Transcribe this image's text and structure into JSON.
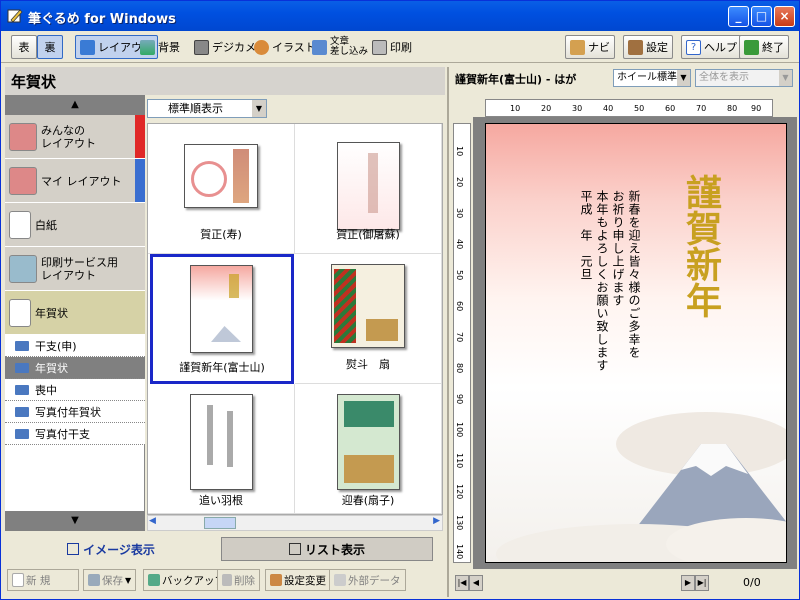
{
  "window": {
    "title": "筆ぐるめ for Windows",
    "controls": {
      "minimize": "_",
      "maximize": "□",
      "close": "×"
    }
  },
  "toolbar": {
    "front_label": "表",
    "back_label": "裏",
    "layout_label": "レイアウト",
    "background_label": "背景",
    "camera_label": "デジカメ",
    "illust_label": "イラスト",
    "text_label_1": "文章",
    "text_label_2": "差し込み",
    "print_label": "印刷",
    "navi_label": "ナビ",
    "settings_label": "設定",
    "help_label": "ヘルプ",
    "exit_label": "終了"
  },
  "left_pane": {
    "header": "年賀状",
    "scroll_up": "▲",
    "scroll_down": "▼",
    "categories": [
      {
        "label1": "みんなの",
        "label2": "レイアウト"
      },
      {
        "label1": "マイ レイアウト",
        "label2": ""
      },
      {
        "label1": "白紙",
        "label2": ""
      },
      {
        "label1": "印刷サービス用",
        "label2": "レイアウト"
      },
      {
        "label1": "年賀状",
        "label2": ""
      }
    ],
    "folders": [
      "干支(申)",
      "年賀状",
      "喪中",
      "写真付年賀状",
      "写真付干支"
    ],
    "selected_folder": "年賀状",
    "sort": {
      "selected": "標準順表示"
    },
    "thumbnails": [
      "賀正(寿)",
      "賀正(御屠蘇)",
      "謹賀新年(富士山)",
      "熨斗　扇",
      "追い羽根",
      "迎春(扇子)"
    ],
    "selected_thumbnail": "謹賀新年(富士山)",
    "tab_image": "イメージ表示",
    "tab_list": "リスト表示"
  },
  "bottom_toolbar": {
    "new": "新 規",
    "save": "保存",
    "backup": "バックアップ",
    "delete": "削除",
    "settings_change": "設定変更",
    "external": "外部データ"
  },
  "right_pane": {
    "title": "謹賀新年(富士山) - はが",
    "wheel_mode": "ホイール標準",
    "view_mode": "全体を表示",
    "ruler_top": [
      "10",
      "20",
      "30",
      "40",
      "50",
      "60",
      "70",
      "80",
      "90"
    ],
    "ruler_left": [
      "10",
      "20",
      "30",
      "40",
      "50",
      "60",
      "70",
      "80",
      "90",
      "100",
      "110",
      "120",
      "130",
      "140"
    ],
    "card_greeting": "謹賀新年",
    "card_body": [
      "新春を迎え皆々様のご多幸を",
      "お祈り申し上げます",
      "本年もよろしくお願い致します",
      "平成　年　元旦"
    ],
    "page_count": "0/0"
  }
}
